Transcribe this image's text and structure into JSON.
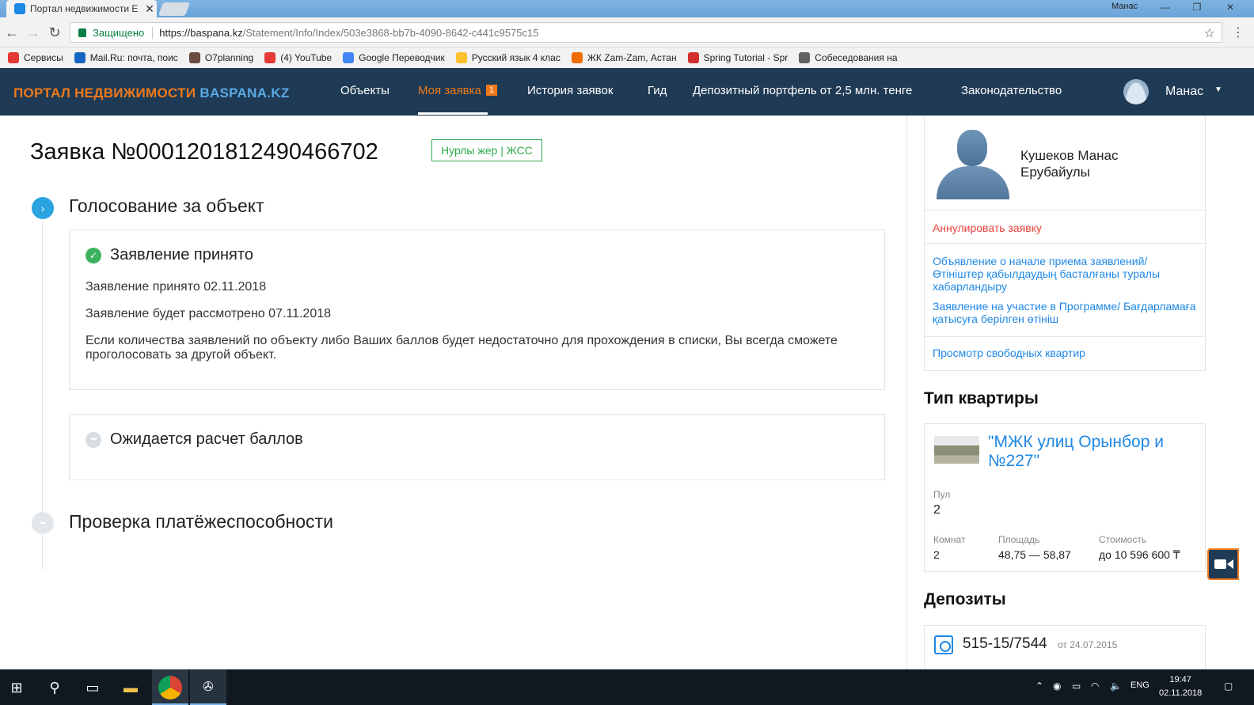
{
  "browser": {
    "tab_title": "Портал недвижимости Е",
    "window_user": "Манас",
    "secure_label": "Защищено",
    "url_host": "https://baspana.kz",
    "url_path": "/Statement/Info/Index/503e3868-bb7b-4090-8642-c441c9575c15",
    "bookmarks": [
      {
        "label": "Сервисы",
        "color": "#e53935"
      },
      {
        "label": "Mail.Ru: почта, поис",
        "color": "#1565c0"
      },
      {
        "label": "O7planning",
        "color": "#6d4c41"
      },
      {
        "label": "(4) YouTube",
        "color": "#e53935"
      },
      {
        "label": "Google Переводчик",
        "color": "#4285f4"
      },
      {
        "label": "Русский язык 4 клас",
        "color": "#fbc02d"
      },
      {
        "label": "ЖК Zam-Zam, Астан",
        "color": "#ef6c00"
      },
      {
        "label": "Spring Tutorial - Spr",
        "color": "#d32f2f"
      },
      {
        "label": "Собеседования на",
        "color": "#616161"
      }
    ]
  },
  "header": {
    "logo_part1": "ПОРТАЛ НЕДВИЖИМОСТИ",
    "logo_part2": "BASPANA.KZ",
    "nav": [
      "Объекты",
      "Моя заявка",
      "История заявок",
      "Гид",
      "Депозитный портфель от 2,5 млн. тенге",
      "Законодательство"
    ],
    "badge": "1",
    "user": "Манас"
  },
  "main": {
    "title": "Заявка №0001201812490466702",
    "tag": "Нурлы жер | ЖСС",
    "step1_title": "Голосование за объект",
    "card1": {
      "heading": "Заявление принято",
      "line1": "Заявление принято 02.11.2018",
      "line2": "Заявление будет рассмотрено 07.11.2018",
      "line3": "Если количества заявлений по объекту либо Ваших баллов будет недостаточно для прохождения в списки, Вы всегда сможете проголосовать за другой объект."
    },
    "card2_heading": "Ожидается расчет баллов",
    "step2_title": "Проверка платёжеспособности"
  },
  "sidebar": {
    "name_line1": "Кушеков Манас",
    "name_line2": "Ерубайулы",
    "cancel": "Аннулировать заявку",
    "link1": "Объявление о начале приема заявлений/ Өтініштер қабылдаудың басталғаны туралы хабарландыру",
    "link2": "Заявление на участие в Программе/ Бағдарламаға қатысуға берілген өтініш",
    "link3": "Просмотр свободных квартир",
    "apt_section": "Тип квартиры",
    "apt_name": "\"МЖК улиц Орынбор и №227\"",
    "pool_label": "Пул",
    "pool_value": "2",
    "rooms_label": "Комнат",
    "rooms_value": "2",
    "area_label": "Площадь",
    "area_value": "48,75 — 58,87",
    "cost_label": "Стоимость",
    "cost_value": "до 10 596 600 ₸",
    "deposits_section": "Депозиты",
    "deposit_number": "515-15/7544",
    "deposit_date": "от 24.07.2015"
  },
  "taskbar": {
    "lang": "ENG",
    "time": "19:47",
    "date": "02.11.2018"
  }
}
